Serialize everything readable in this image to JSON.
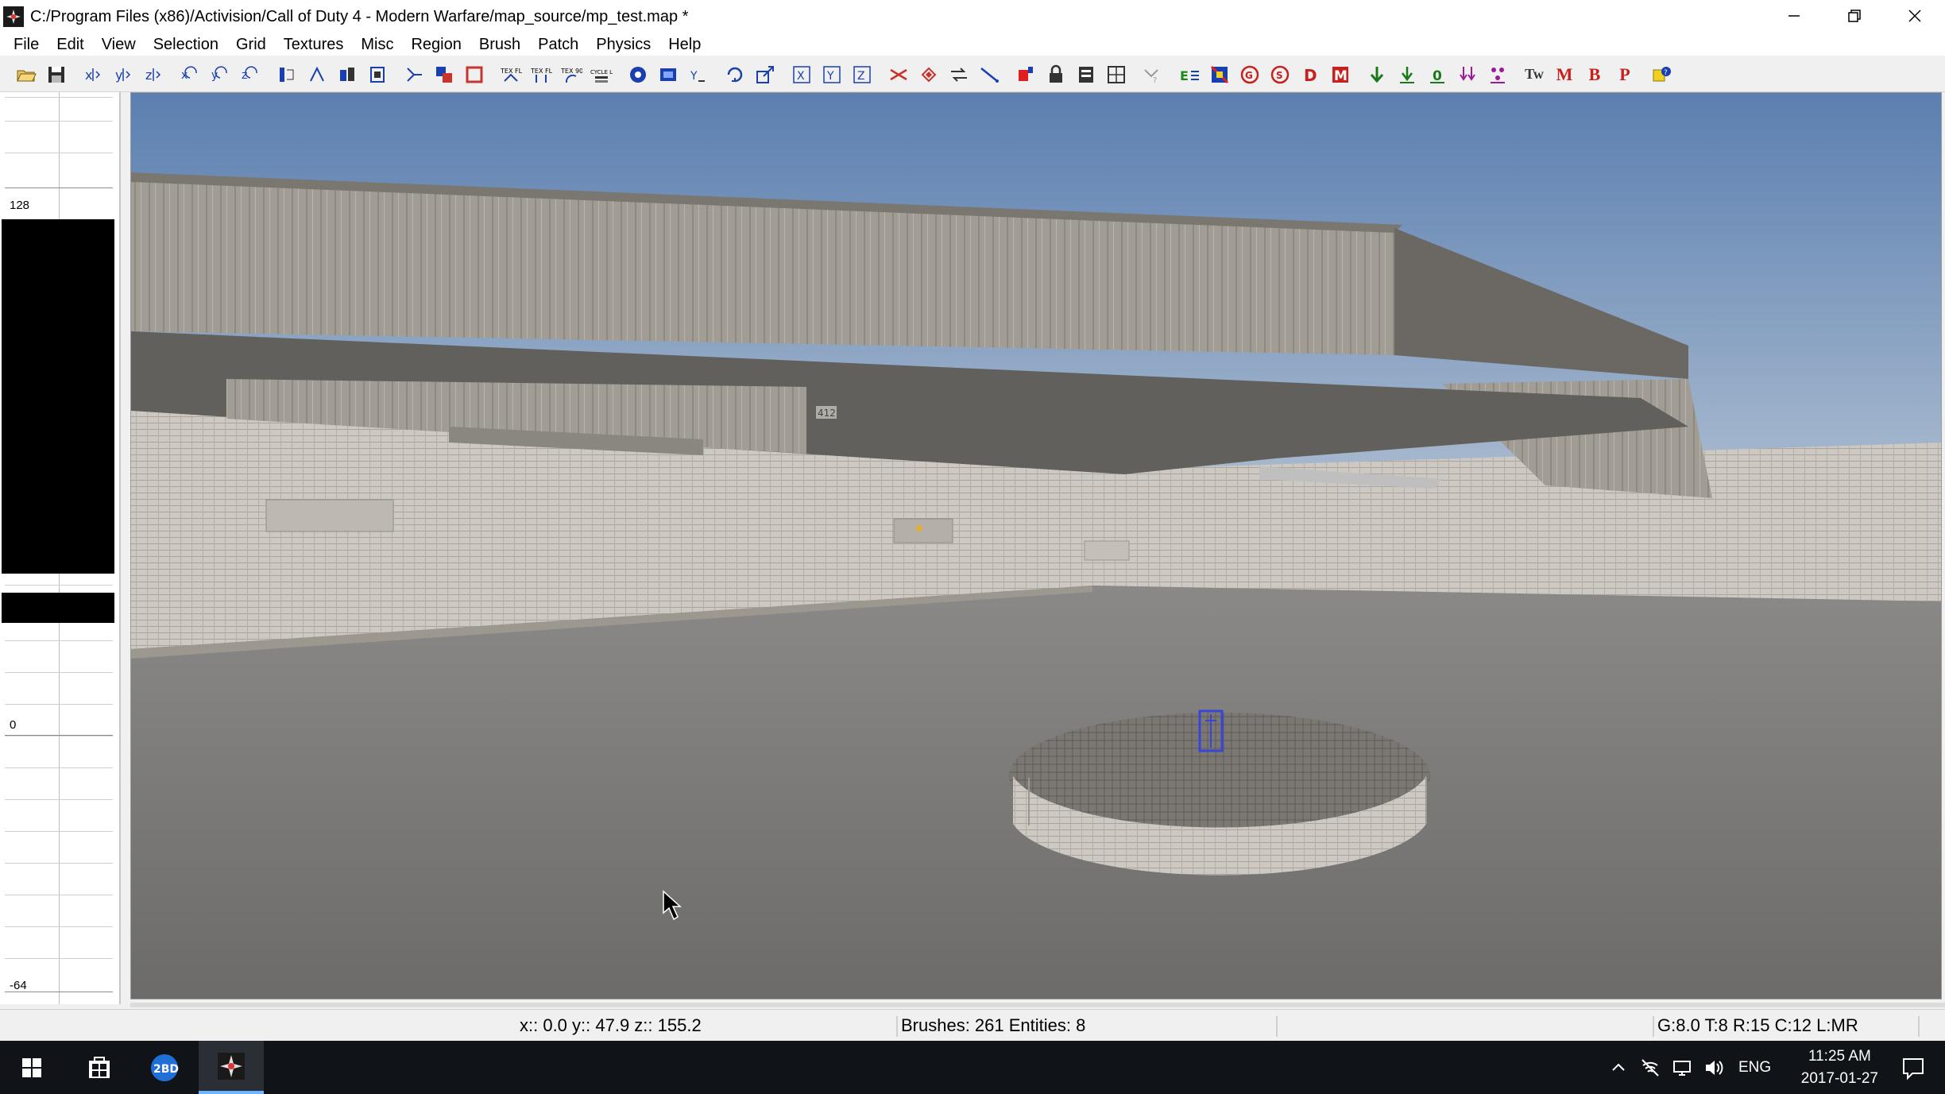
{
  "window": {
    "title": "C:/Program Files (x86)/Activision/Call of Duty 4 - Modern Warfare/map_source/mp_test.map *",
    "app_icon": "radiant-icon",
    "controls": [
      "minimize-icon",
      "restore-icon",
      "close-icon"
    ]
  },
  "menu": {
    "items": [
      "File",
      "Edit",
      "View",
      "Selection",
      "Grid",
      "Textures",
      "Misc",
      "Region",
      "Brush",
      "Patch",
      "Physics",
      "Help"
    ]
  },
  "toolbar": {
    "buttons": [
      "open-icon",
      "save-icon",
      "flip-x-icon",
      "flip-y-icon",
      "flip-z-icon",
      "rotate-x-icon",
      "rotate-y-icon",
      "rotate-z-icon",
      "select-complete-icon",
      "select-touching-icon",
      "select-inside-icon",
      "select-partial-icon",
      "csg-subtract-icon",
      "csg-merge-icon",
      "hollow-icon",
      "texture-flip-icon",
      "texture-fit-icon",
      "texture-90-icon",
      "cycle-layer-icon",
      "camera-mode-icon",
      "cubic-clip-icon",
      "view-change-icon",
      "rotate-mode-icon",
      "scale-mode-icon",
      "x-axis-icon",
      "y-axis-icon",
      "z-axis-icon",
      "vertex-edit-icon",
      "patch-icon",
      "curve-icon",
      "clipper-icon",
      "region-icon",
      "lock-icon",
      "entity-list-icon",
      "texture-lock-icon",
      "filter-icon",
      "prefab-icon",
      "lights-icon",
      "stop-icon",
      "delete-icon",
      "drop-icon",
      "misc-model-icon",
      "drop-to-floor-icon",
      "move-down-icon",
      "zero-icon",
      "pair-icon",
      "group-icon"
    ],
    "text_buttons": [
      "Tw",
      "M",
      "B",
      "P"
    ],
    "small_labels": [
      "TEX FLIP",
      "TEX FLIP",
      "TEX 90",
      "CYCLE LAYER"
    ],
    "end_icon": "help-icon"
  },
  "zview": {
    "labels": [
      "128",
      "0",
      "-64"
    ]
  },
  "camera": {
    "name": "3D camera view",
    "sky_top": "#5b7fb0",
    "sky_bottom": "#c9d3dc",
    "wall_color": "#c8c5bf",
    "floor_color": "#7d7d7b",
    "concrete_color": "#9a968e",
    "entity_color": "#3a45d8",
    "sign_text": "412"
  },
  "status": {
    "coords": "x:: 0.0  y:: 47.9  z:: 155.2",
    "counts": "Brushes: 261 Entities: 8",
    "grid_info": "G:8.0 T:8 R:15 C:12 L:MR"
  },
  "taskbar": {
    "apps": [
      "start-icon",
      "store-icon",
      "2bd-app-icon",
      "radiant-task-icon"
    ],
    "app2_label": "2BD",
    "tray": {
      "lang": "ENG",
      "time": "11:25 AM",
      "date": "2017-01-27"
    }
  },
  "colors": {
    "titlebar": "#ffffff",
    "toolbar": "#f0f0f0",
    "taskbar": "#101418",
    "accent": "#6cb4ff"
  }
}
